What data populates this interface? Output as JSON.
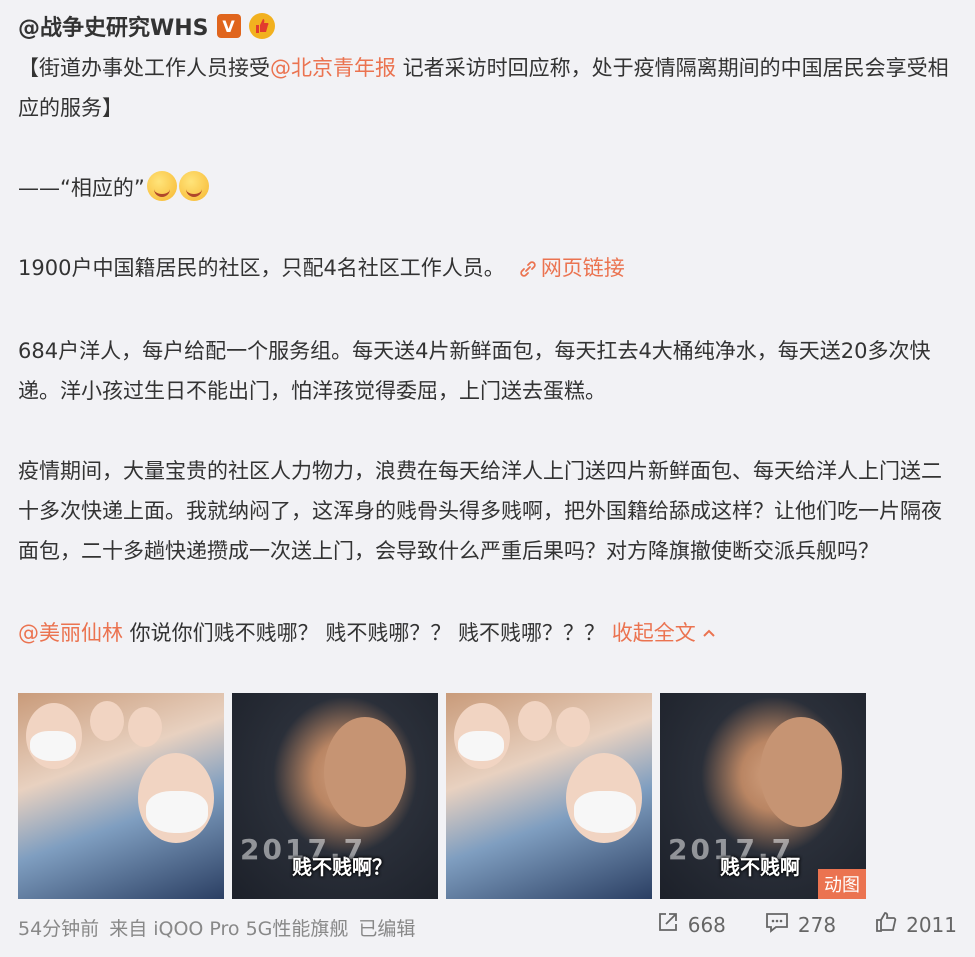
{
  "header": {
    "username": "@战争史研究WHS",
    "verified_badge": "V",
    "medal_glyph": "👍"
  },
  "post": {
    "p1_prefix": "【街道办事处工作人员接受",
    "p1_mention": "@北京青年报",
    "p1_suffix": " 记者采访时回应称，处于疫情隔离期间的中国居民会享受相应的服务】",
    "p2": "——“相应的”",
    "p3": "1900户中国籍居民的社区，只配4名社区工作人员。",
    "p3_link": "网页链接",
    "p4": "684户洋人，每户给配一个服务组。每天送4片新鲜面包，每天扛去4大桶纯净水，每天送20多次快递。洋小孩过生日不能出门，怕洋孩觉得委屈，上门送去蛋糕。",
    "p5": "疫情期间，大量宝贵的社区人力物力，浪费在每天给洋人上门送四片新鲜面包、每天给洋人上门送二十多次快递上面。我就纳闷了，这浑身的贱骨头得多贱啊，把外国籍给舔成这样？让他们吃一片隔夜面包，二十多趟快递攒成一次送上门，会导致什么严重后果吗？对方降旗撤使断交派兵舰吗？",
    "p6_mention": "@美丽仙林",
    "p6_text": " 你说你们贱不贱哪？ 贱不贱哪？？ 贱不贱哪？？？ ",
    "collapse_label": "收起全文"
  },
  "images": [
    {
      "type": "selfie",
      "caption": ""
    },
    {
      "type": "actor",
      "caption": "贱不贱啊？",
      "watermark": "2017.7"
    },
    {
      "type": "selfie",
      "caption": ""
    },
    {
      "type": "actor",
      "caption": "贱不贱啊",
      "watermark": "2017.7",
      "badge": "动图"
    }
  ],
  "footer": {
    "time": "54分钟前",
    "source": "来自 iQOO Pro 5G性能旗舰",
    "edited": "已编辑"
  },
  "stats": {
    "reposts": "668",
    "comments": "278",
    "likes": "2011"
  },
  "colors": {
    "accent": "#eb7350",
    "background": "#f2f2f5",
    "text": "#333333",
    "muted": "#888888"
  }
}
